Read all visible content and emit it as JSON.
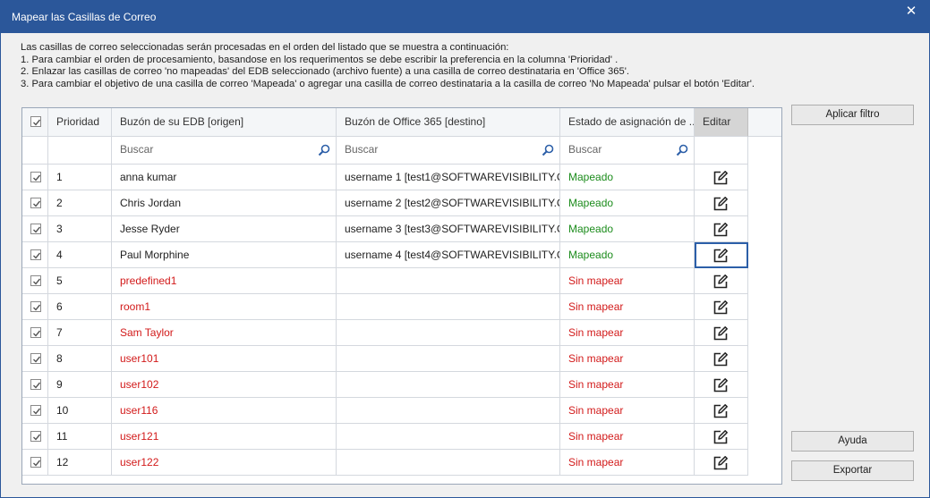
{
  "window": {
    "title": "Mapear las Casillas de Correo",
    "close_glyph": "✕"
  },
  "instructions": [
    "Las casillas de correo seleccionadas serán procesadas en el orden del listado que se muestra a continuación:",
    "1. Para cambiar el orden de procesamiento, basandose en los requerimentos se debe escribir la preferencia en la columna 'Prioridad' .",
    "2. Enlazar las casillas de correo  'no mapeadas' del EDB seleccionado (archivo fuente) a una casilla de correo destinataria en 'Office 365'.",
    "3. Para cambiar el objetivo de una casilla de correo  'Mapeada' o agregar una casilla de correo destinataria a la casilla de correo   'No Mapeada' pulsar el botón 'Editar'."
  ],
  "table": {
    "headers": {
      "priority": "Prioridad",
      "source": "Buzón de su EDB [origen]",
      "destination": "Buzón de Office 365 [destino]",
      "status": "Estado de asignación de ...",
      "edit": "Editar"
    },
    "search_placeholder": "Buscar",
    "rows": [
      {
        "priority": "1",
        "source": "anna kumar",
        "destination": "username 1 [test1@SOFTWAREVISIBILITY.C...",
        "status": "Mapeado",
        "mapped": true,
        "checked": true
      },
      {
        "priority": "2",
        "source": "Chris Jordan",
        "destination": "username 2 [test2@SOFTWAREVISIBILITY.C...",
        "status": "Mapeado",
        "mapped": true,
        "checked": true
      },
      {
        "priority": "3",
        "source": "Jesse Ryder",
        "destination": "username 3 [test3@SOFTWAREVISIBILITY.C...",
        "status": "Mapeado",
        "mapped": true,
        "checked": true
      },
      {
        "priority": "4",
        "source": "Paul Morphine",
        "destination": "username 4 [test4@SOFTWAREVISIBILITY.C...",
        "status": "Mapeado",
        "mapped": true,
        "checked": true,
        "selected": true
      },
      {
        "priority": "5",
        "source": "predefined1",
        "destination": "",
        "status": "Sin mapear",
        "mapped": false,
        "checked": true
      },
      {
        "priority": "6",
        "source": "room1",
        "destination": "",
        "status": "Sin mapear",
        "mapped": false,
        "checked": true
      },
      {
        "priority": "7",
        "source": "Sam Taylor",
        "destination": "",
        "status": "Sin mapear",
        "mapped": false,
        "checked": true
      },
      {
        "priority": "8",
        "source": "user101",
        "destination": "",
        "status": "Sin mapear",
        "mapped": false,
        "checked": true
      },
      {
        "priority": "9",
        "source": "user102",
        "destination": "",
        "status": "Sin mapear",
        "mapped": false,
        "checked": true
      },
      {
        "priority": "10",
        "source": "user116",
        "destination": "",
        "status": "Sin mapear",
        "mapped": false,
        "checked": true
      },
      {
        "priority": "11",
        "source": "user121",
        "destination": "",
        "status": "Sin mapear",
        "mapped": false,
        "checked": true
      },
      {
        "priority": "12",
        "source": "user122",
        "destination": "",
        "status": "Sin mapear",
        "mapped": false,
        "checked": true
      }
    ]
  },
  "buttons": {
    "apply_filter": "Aplicar filtro",
    "help": "Ayuda",
    "export": "Exportar"
  },
  "colors": {
    "titlebar": "#2b579a",
    "mapped": "#1c8c1c",
    "unmapped": "#d21a1a",
    "selection": "#2c5fa8"
  },
  "icons": {
    "close": "close-icon",
    "search": "search-icon",
    "edit": "edit-icon",
    "checkbox": "checkbox-checked-icon"
  }
}
